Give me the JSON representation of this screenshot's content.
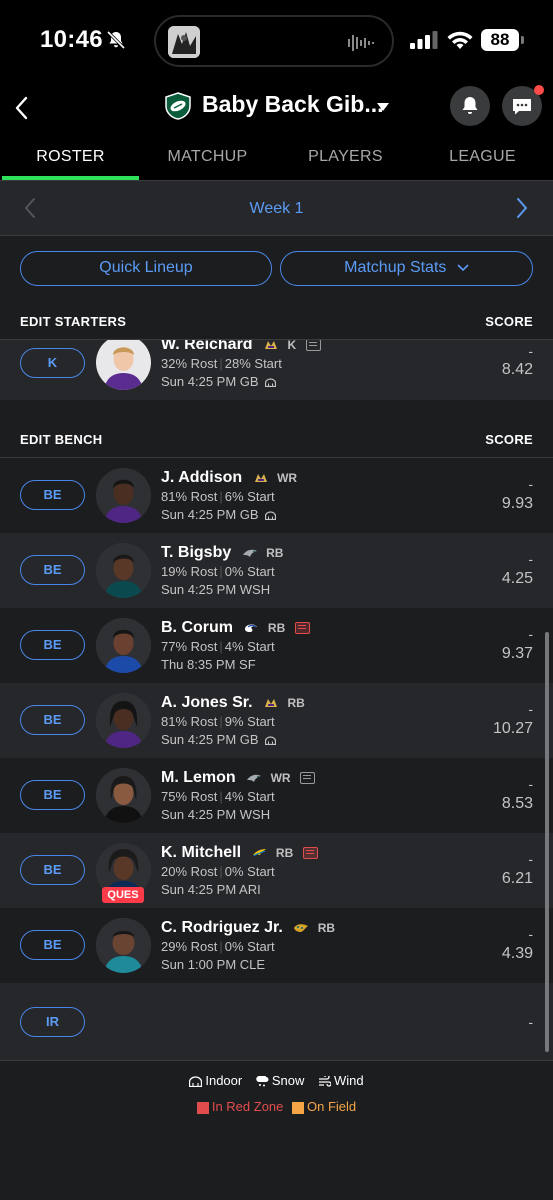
{
  "status_bar": {
    "time": "10:46",
    "battery": "88"
  },
  "header": {
    "team_name": "Baby Back Gib..."
  },
  "tabs": [
    {
      "label": "ROSTER",
      "active": true
    },
    {
      "label": "MATCHUP",
      "active": false
    },
    {
      "label": "PLAYERS",
      "active": false
    },
    {
      "label": "LEAGUE",
      "active": false
    }
  ],
  "week": {
    "label": "Week 1"
  },
  "actions": {
    "quick_lineup": "Quick Lineup",
    "matchup_stats": "Matchup Stats"
  },
  "starters": {
    "title": "EDIT STARTERS",
    "score_label": "SCORE",
    "players": [
      {
        "slot": "K",
        "name": "W. Reichard",
        "team": "MIN",
        "pos": "K",
        "rost": "32% Rost",
        "start": "28% Start",
        "game": "Sun 4:25 PM GB",
        "dash": "-",
        "proj": "8.42"
      }
    ]
  },
  "bench": {
    "title": "EDIT BENCH",
    "score_label": "SCORE",
    "players": [
      {
        "slot": "BE",
        "name": "J. Addison",
        "team": "MIN",
        "pos": "WR",
        "rost": "81% Rost",
        "start": "6% Start",
        "game": "Sun 4:25 PM GB",
        "dash": "-",
        "proj": "9.93"
      },
      {
        "slot": "BE",
        "name": "T. Bigsby",
        "team": "PHI",
        "pos": "RB",
        "rost": "19% Rost",
        "start": "0% Start",
        "game": "Sun 4:25 PM WSH",
        "dash": "-",
        "proj": "4.25"
      },
      {
        "slot": "BE",
        "name": "B. Corum",
        "team": "LAR",
        "pos": "RB",
        "rost": "77% Rost",
        "start": "4% Start",
        "game": "Thu 8:35 PM SF",
        "dash": "-",
        "proj": "9.37"
      },
      {
        "slot": "BE",
        "name": "A. Jones Sr.",
        "team": "MIN",
        "pos": "RB",
        "rost": "81% Rost",
        "start": "9% Start",
        "game": "Sun 4:25 PM GB",
        "dash": "-",
        "proj": "10.27"
      },
      {
        "slot": "BE",
        "name": "M. Lemon",
        "team": "PHI",
        "pos": "WR",
        "rost": "75% Rost",
        "start": "4% Start",
        "game": "Sun 4:25 PM WSH",
        "dash": "-",
        "proj": "8.53"
      },
      {
        "slot": "BE",
        "name": "K. Mitchell",
        "team": "LAC",
        "pos": "RB",
        "rost": "20% Rost",
        "start": "0% Start",
        "game": "Sun 4:25 PM ARI",
        "dash": "-",
        "proj": "6.21",
        "injury": "QUES"
      },
      {
        "slot": "BE",
        "name": "C. Rodriguez Jr.",
        "team": "JAX",
        "pos": "RB",
        "rost": "29% Rost",
        "start": "0% Start",
        "game": "Sun 1:00 PM CLE",
        "dash": "-",
        "proj": "4.39"
      }
    ]
  },
  "ir": {
    "slot": "IR",
    "score": "-"
  },
  "legend": {
    "indoor": "Indoor",
    "snow": "Snow",
    "wind": "Wind",
    "red_zone": "In Red Zone",
    "on_field": "On Field",
    "red_zone_color": "#e24c4c",
    "on_field_color": "#f5a545"
  },
  "colors": {
    "accent_blue": "#5b9bf5",
    "tab_underline": "#2ee05a",
    "ques_badge": "#ff3b4a"
  }
}
